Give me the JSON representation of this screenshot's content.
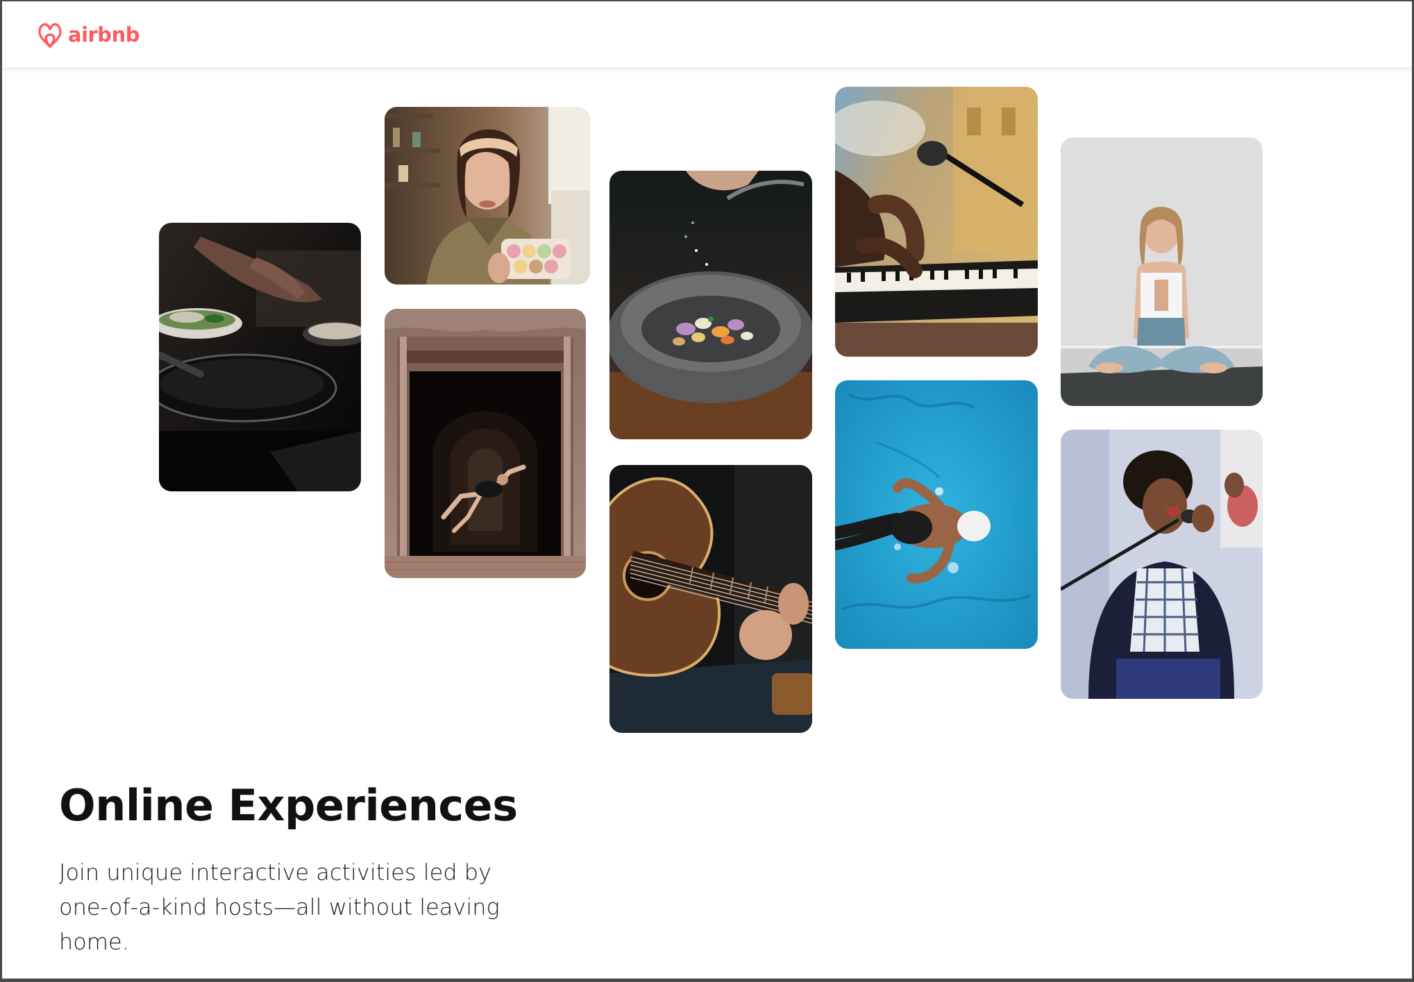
{
  "brand": {
    "name": "airbnb",
    "color": "#ff5a5f",
    "icon": "airbnb-belo-icon"
  },
  "hero": {
    "title": "Online Experiences",
    "description": "Join unique interactive activities led by one-of-a-kind hosts—all without leaving home."
  },
  "gallery": [
    {
      "name": "photo-cooking-pans",
      "subject": "hands cooking with pans"
    },
    {
      "name": "photo-baker-macarons",
      "subject": "woman holding macarons"
    },
    {
      "name": "photo-dancer-archway",
      "subject": "dancer leaping in archway"
    },
    {
      "name": "photo-stone-bowl-seasoning",
      "subject": "seasoning a stone bowl"
    },
    {
      "name": "photo-acoustic-guitar",
      "subject": "playing acoustic guitar"
    },
    {
      "name": "photo-piano-microphone",
      "subject": "hands on keyboard with microphone"
    },
    {
      "name": "photo-swimmer-pool",
      "subject": "swimmer in blue pool"
    },
    {
      "name": "photo-yoga-meditation",
      "subject": "woman meditating in yoga pose"
    },
    {
      "name": "photo-singer-microphone",
      "subject": "singer at microphone"
    }
  ]
}
